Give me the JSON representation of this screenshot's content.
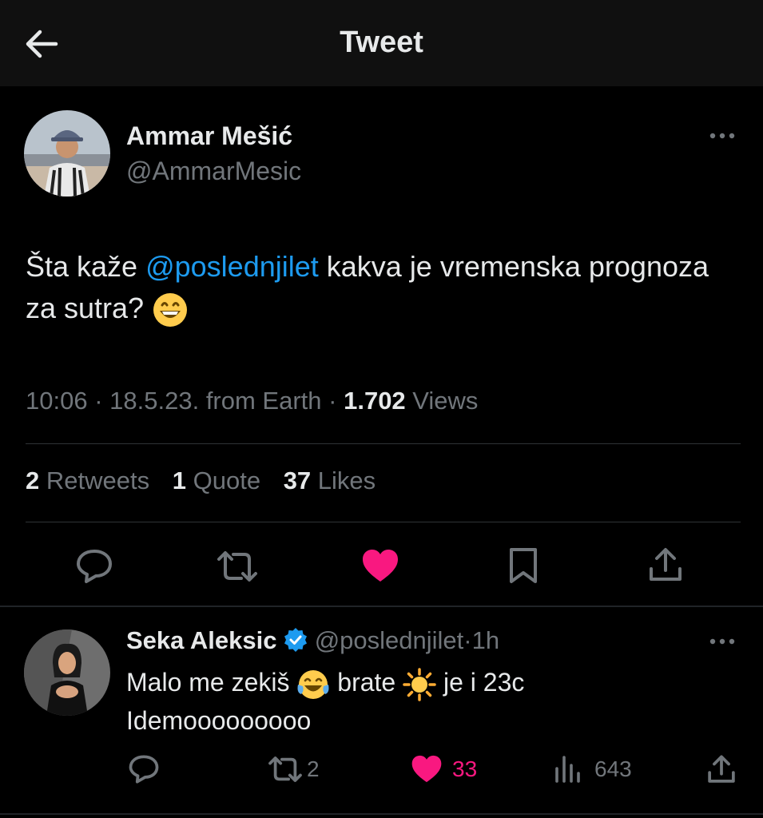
{
  "header": {
    "title": "Tweet"
  },
  "tweet": {
    "author_name": "Ammar Mešić",
    "author_handle": "@AmmarMesic",
    "text_before": "Šta kaže ",
    "mention": "@poslednjilet",
    "text_after": " kakva je vremenska prognoza za sutra? ",
    "emoji_icon": "grinning-face-emoji",
    "time": "10:06",
    "date": "18.5.23.",
    "source": "from Earth",
    "views_count": "1.702",
    "views_label": "Views",
    "retweets_count": "2",
    "retweets_label": "Retweets",
    "quotes_count": "1",
    "quotes_label": "Quote",
    "likes_count": "37",
    "likes_label": "Likes",
    "liked": true,
    "like_color": "#f91880"
  },
  "reply": {
    "author_name": "Seka Aleksic",
    "verified": true,
    "author_handle": "@poslednjilet",
    "age": "1h",
    "line1_a": "Malo me zekiš ",
    "line1_b": " brate ",
    "line1_c": " je i 23c",
    "line2": "Idemooooooooo",
    "emoji1_icon": "tears-of-joy-emoji",
    "emoji2_icon": "sun-emoji",
    "retweets": "2",
    "likes": "33",
    "views": "643"
  },
  "colors": {
    "accent": "#1d9bf0",
    "like": "#f91880",
    "muted": "#71767b",
    "text": "#e7e9ea",
    "background": "#000000"
  }
}
